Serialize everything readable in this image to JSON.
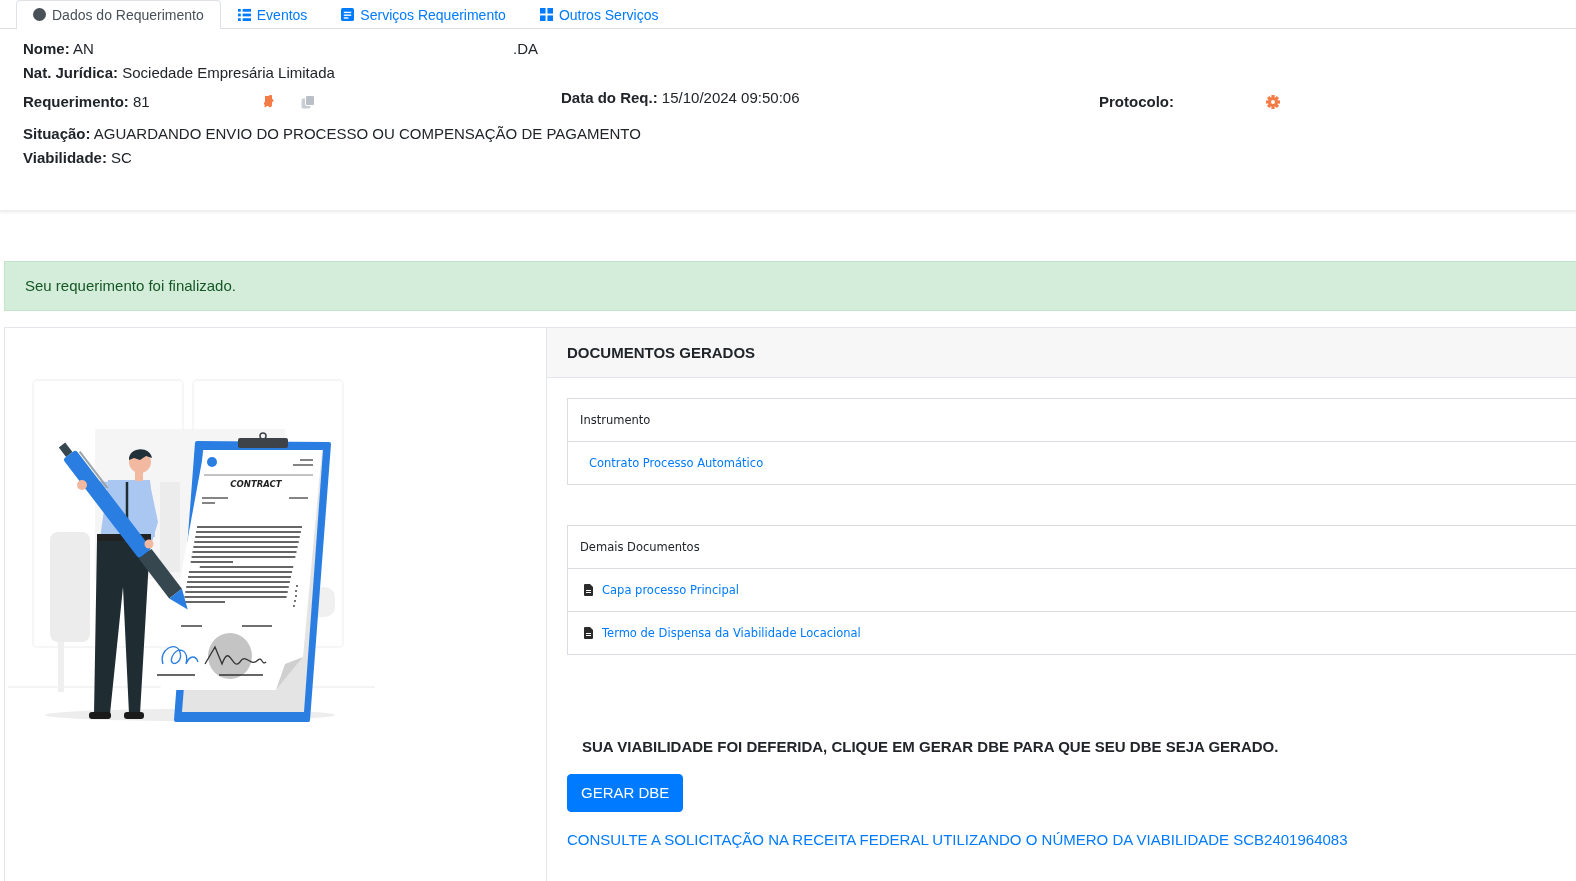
{
  "tabs": [
    {
      "label": "Dados do Requerimento",
      "selected": true
    },
    {
      "label": "Eventos",
      "selected": false
    },
    {
      "label": "Serviços Requerimento",
      "selected": false
    },
    {
      "label": "Outros Serviços",
      "selected": false
    }
  ],
  "header": {
    "name": {
      "label": "Nome:",
      "value": "AN",
      "value_tail": ".DA"
    },
    "legal_nature": {
      "label": "Nat. Jurídica:",
      "value": "Sociedade Empresária Limitada"
    },
    "request": {
      "label": "Requerimento:",
      "value": "81"
    },
    "request_date": {
      "label": "Data do Req.:",
      "value": "15/10/2024 09:50:06"
    },
    "protocol": {
      "label": "Protocolo:"
    },
    "status": {
      "label": "Situação:",
      "value": "AGUARDANDO ENVIO DO PROCESSO OU COMPENSAÇÃO DE PAGAMENTO"
    },
    "viability": {
      "label": "Viabilidade:",
      "value": "SC"
    }
  },
  "alert": {
    "text": "Seu requerimento foi finalizado."
  },
  "illustration": {
    "caption": "CONTRACT"
  },
  "documents": {
    "title": "DOCUMENTOS GERADOS",
    "groups": [
      {
        "title": "Instrumento",
        "items": [
          {
            "kind": "link",
            "label": "Contrato Processo Automático"
          }
        ]
      },
      {
        "title": "Demais Documentos",
        "items": [
          {
            "kind": "file",
            "label": "Capa processo Principal"
          },
          {
            "kind": "file",
            "label": "Termo de Dispensa da Viabilidade Locacional"
          }
        ]
      }
    ]
  },
  "notice": "SUA VIABILIDADE FOI DEFERIDA, CLIQUE EM GERAR DBE PARA QUE SEU DBE SEJA GERADO.",
  "button": "GERAR DBE",
  "link": "CONSULTE A SOLICITAÇÃO NA RECEITA FEDERAL UTILIZANDO O NÚMERO DA VIABILIDADE SCB2401964083"
}
